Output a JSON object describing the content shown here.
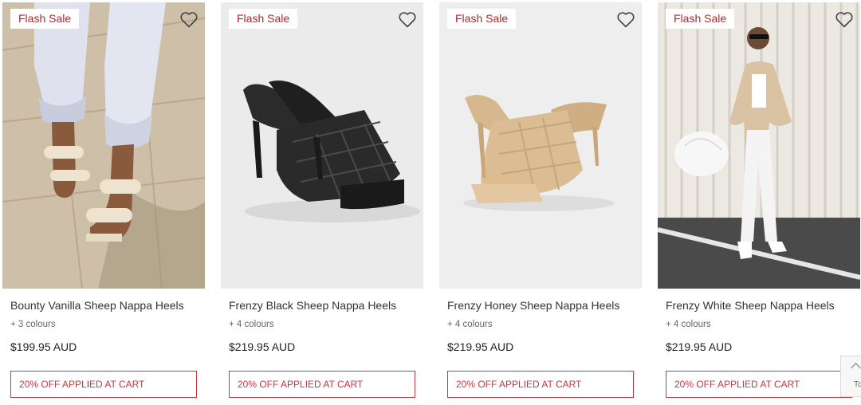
{
  "products": [
    {
      "badge": "Flash Sale",
      "title": "Bounty Vanilla Sheep Nappa Heels",
      "colours": "+ 3 colours",
      "price": "$199.95 AUD",
      "promo": "20% OFF APPLIED AT CART"
    },
    {
      "badge": "Flash Sale",
      "title": "Frenzy Black Sheep Nappa Heels",
      "colours": "+ 4 colours",
      "price": "$219.95 AUD",
      "promo": "20% OFF APPLIED AT CART"
    },
    {
      "badge": "Flash Sale",
      "title": "Frenzy Honey Sheep Nappa Heels",
      "colours": "+ 4 colours",
      "price": "$219.95 AUD",
      "promo": "20% OFF APPLIED AT CART"
    },
    {
      "badge": "Flash Sale",
      "title": "Frenzy White Sheep Nappa Heels",
      "colours": "+ 4 colours",
      "price": "$219.95 AUD",
      "promo": "20% OFF APPLIED AT CART"
    }
  ],
  "back_to_top": {
    "label": "To"
  },
  "colors": {
    "accent": "#c8383d",
    "badge_text": "#b3262b"
  }
}
